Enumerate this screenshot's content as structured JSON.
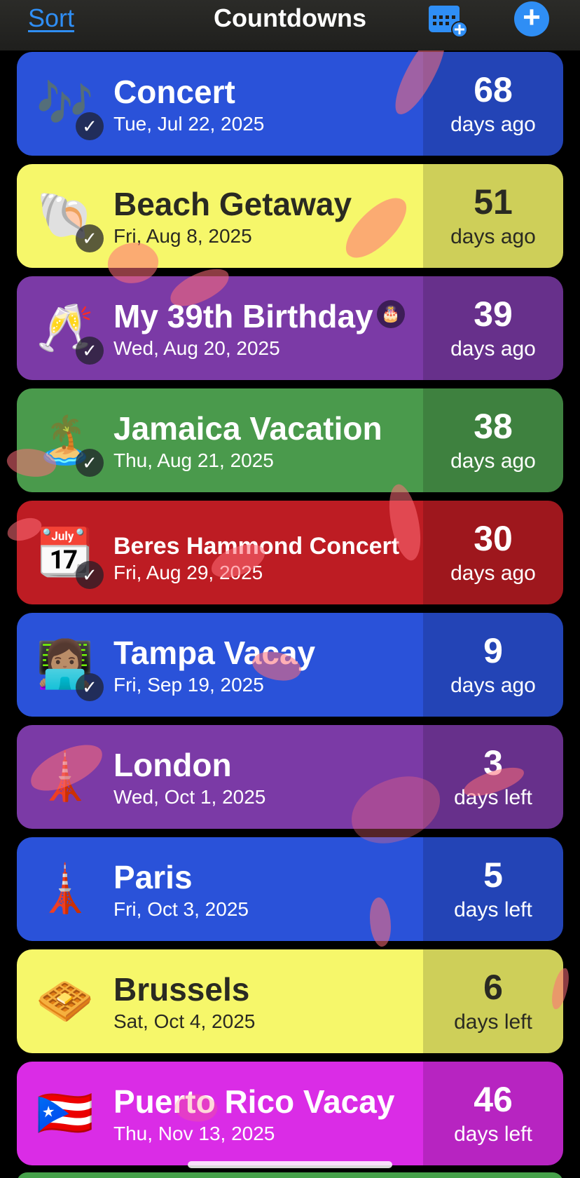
{
  "nav": {
    "sort_label": "Sort",
    "title": "Countdowns",
    "calendar_icon": "calendar-add-icon",
    "add_icon": "plus-circle-icon"
  },
  "countdowns": [
    {
      "emoji": "🎶",
      "title": "Concert",
      "date": "Tue, Jul 22, 2025",
      "count": "68",
      "unit": "days ago",
      "color": "#2a52d9",
      "completed": true
    },
    {
      "emoji": "🐚",
      "title": "Beach Getaway",
      "date": "Fri, Aug 8, 2025",
      "count": "51",
      "unit": "days ago",
      "color": "#f6f76a",
      "completed": true
    },
    {
      "emoji": "🥂",
      "title": "My 39th Birthday",
      "date": "Wed, Aug 20, 2025",
      "count": "39",
      "unit": "days ago",
      "color": "#7b3aa6",
      "completed": true
    },
    {
      "emoji": "🏝️",
      "title": "Jamaica Vacation",
      "date": "Thu, Aug 21, 2025",
      "count": "38",
      "unit": "days ago",
      "color": "#4a9a4c",
      "completed": true
    },
    {
      "emoji": "📆",
      "title": "Beres Hammond Concert",
      "date": "Fri, Aug 29, 2025",
      "count": "30",
      "unit": "days ago",
      "color": "#bd1c23",
      "completed": true
    },
    {
      "emoji": "👩🏽‍💻",
      "title": "Tampa Vacay",
      "date": "Fri, Sep 19, 2025",
      "count": "9",
      "unit": "days ago",
      "color": "#2a52d9",
      "completed": true
    },
    {
      "emoji": "🗼",
      "title": "London",
      "date": "Wed, Oct 1, 2025",
      "count": "3",
      "unit": "days left",
      "color": "#7b3aa6",
      "completed": false
    },
    {
      "emoji": "🗼",
      "title": "Paris",
      "date": "Fri, Oct 3, 2025",
      "count": "5",
      "unit": "days left",
      "color": "#2a52d9",
      "completed": false
    },
    {
      "emoji": "🧇",
      "title": "Brussels",
      "date": "Sat, Oct 4, 2025",
      "count": "6",
      "unit": "days left",
      "color": "#f6f76a",
      "completed": false
    },
    {
      "emoji": "🇵🇷",
      "title": "Puerto Rico Vacay",
      "date": "Thu, Nov 13, 2025",
      "count": "46",
      "unit": "days left",
      "color": "#da2ce6",
      "completed": false
    }
  ],
  "birthday_badge_icon": "birthday-cake-icon"
}
